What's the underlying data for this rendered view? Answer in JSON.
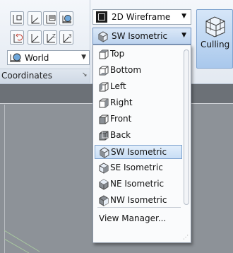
{
  "ribbon": {
    "coordinates_panel": {
      "title": "Coordinates",
      "launcher_icon": "panel-launcher-arrow-icon",
      "ucs_combo": {
        "value": "World",
        "icon": "world-ucs-icon"
      },
      "tool_icons": [
        "ucs-icon",
        "ucs-origin-icon",
        "ucs-named-icon",
        "ucs-view-icon",
        "ucs-previous-icon",
        "ucs-x-icon",
        "ucs-z-axis-icon",
        "ucs-3point-icon"
      ]
    },
    "visual_style_combo": {
      "value": "2D Wireframe",
      "icon": "visual-style-swatch-icon"
    },
    "view_combo": {
      "value": "SW Isometric",
      "icon": "sw-isometric-icon"
    },
    "culling_button": {
      "label": "Culling",
      "icon": "wireframe-cube-icon"
    }
  },
  "view_dropdown": {
    "items": [
      {
        "label": "Top",
        "icon": "top-view-icon"
      },
      {
        "label": "Bottom",
        "icon": "bottom-view-icon"
      },
      {
        "label": "Left",
        "icon": "left-view-icon"
      },
      {
        "label": "Right",
        "icon": "right-view-icon"
      },
      {
        "label": "Front",
        "icon": "front-view-icon"
      },
      {
        "label": "Back",
        "icon": "back-view-icon"
      },
      {
        "label": "SW Isometric",
        "icon": "sw-isometric-icon",
        "selected": true
      },
      {
        "label": "SE Isometric",
        "icon": "se-isometric-icon"
      },
      {
        "label": "NE Isometric",
        "icon": "ne-isometric-icon"
      },
      {
        "label": "NW Isometric",
        "icon": "nw-isometric-icon"
      }
    ],
    "view_manager_label": "View Manager..."
  },
  "colors": {
    "selection_border": "#7da2ce",
    "viewport_background": "#8b9096"
  }
}
